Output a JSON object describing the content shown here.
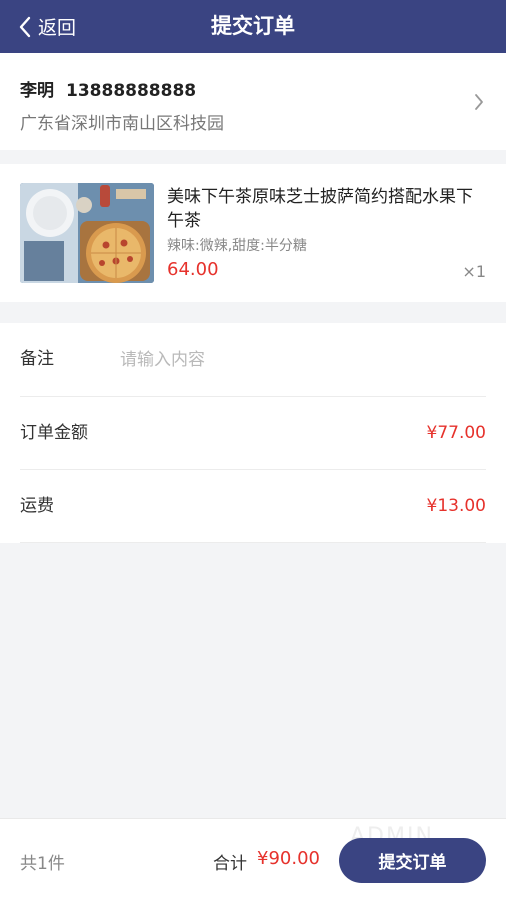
{
  "navbar": {
    "back_label": "返回",
    "title": "提交订单",
    "bg_color": "#3a4482"
  },
  "address": {
    "name": "李明",
    "phone": "13888888888",
    "detail": "广东省深圳市南山区科技园"
  },
  "product": {
    "name": "美味下午茶原味芝士披萨简约搭配水果下午茶",
    "spec": "辣味:微辣,甜度:半分糖",
    "price": "64.00",
    "quantity": "×1",
    "image_icon": "pizza-image"
  },
  "form": {
    "remark_label": "备注",
    "remark_placeholder": "请输入内容",
    "remark_value": "",
    "order_amount_label": "订单金额",
    "order_amount_value": "¥77.00",
    "shipping_label": "运费",
    "shipping_value": "¥13.00"
  },
  "footer": {
    "item_count": "共1件",
    "total_label": "合计",
    "total_amount": "¥90.00",
    "watermark": "ADMIN",
    "submit_label": "提交订单"
  },
  "colors": {
    "accent": "#3a4482",
    "price_red": "#e6322c"
  }
}
